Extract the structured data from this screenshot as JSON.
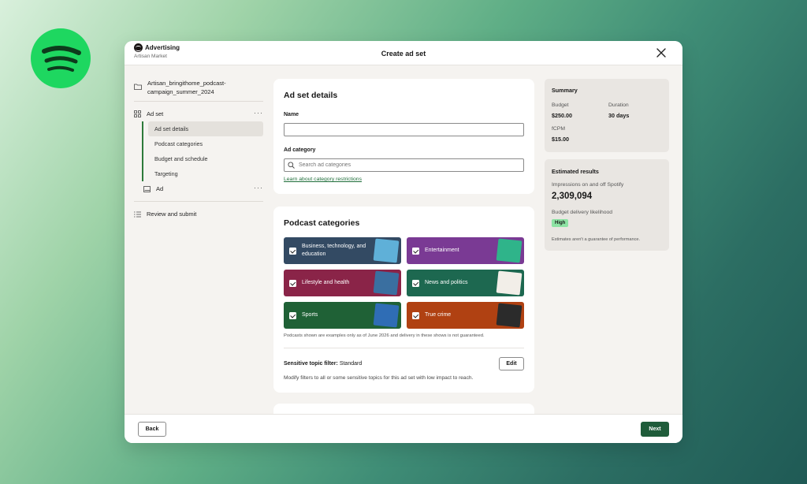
{
  "header": {
    "brand": "Advertising",
    "account": "Artisan Market",
    "title": "Create ad set"
  },
  "sidebar": {
    "campaign": "Artisan_bringithome_podcast-campaign_summer_2024",
    "ad_set": "Ad set",
    "sub_items": [
      "Ad set details",
      "Podcast categories",
      "Budget and schedule",
      "Targeting"
    ],
    "ad": "Ad",
    "review": "Review and submit",
    "more_glyph": "···"
  },
  "details": {
    "title": "Ad set details",
    "name_label": "Name",
    "name_value": "",
    "category_label": "Ad category",
    "category_placeholder": "Search ad categories",
    "learn_link": "Learn about category restrictions"
  },
  "podcast": {
    "title": "Podcast categories",
    "tiles": [
      {
        "label": "Business, technology, and education",
        "color": "#334a63",
        "art": "#5fb0d8",
        "checked": true
      },
      {
        "label": "Entertainment",
        "color": "#7a3a94",
        "art": "#2fb48a",
        "checked": true
      },
      {
        "label": "Lifestyle and health",
        "color": "#8a2448",
        "art": "#3a6fa0",
        "checked": true
      },
      {
        "label": "News and politics",
        "color": "#1d6850",
        "art": "#f2eee8",
        "checked": true
      },
      {
        "label": "Sports",
        "color": "#1f6136",
        "art": "#2f6db5",
        "checked": true
      },
      {
        "label": "True crime",
        "color": "#b04112",
        "art": "#2b2b2b",
        "checked": true
      }
    ],
    "note": "Podcasts shown are examples only as of June 2026 and delivery in these shows is not guaranteed.",
    "sensitive_label": "Sensitive topic filter:",
    "sensitive_value": "Standard",
    "edit": "Edit",
    "sensitive_desc": "Modify filters to all or some sensitive topics for this ad set with low impact to reach."
  },
  "summary": {
    "title": "Summary",
    "budget_label": "Budget",
    "budget_value": "$250.00",
    "duration_label": "Duration",
    "duration_value": "30 days",
    "fcpm_label": "fCPM",
    "fcpm_value": "$15.00"
  },
  "estimated": {
    "title": "Estimated results",
    "impressions_label": "Impressions on and off Spotify",
    "impressions_value": "2,309,094",
    "likelihood_label": "Budget delivery likelihood",
    "likelihood_value": "High",
    "note": "Estimates aren't a guarantee of performance."
  },
  "footer": {
    "back": "Back",
    "next": "Next"
  },
  "colors": {
    "brand_green": "#1ed760",
    "primary_button": "#1f5c3a",
    "badge_green": "#8de3a4"
  }
}
